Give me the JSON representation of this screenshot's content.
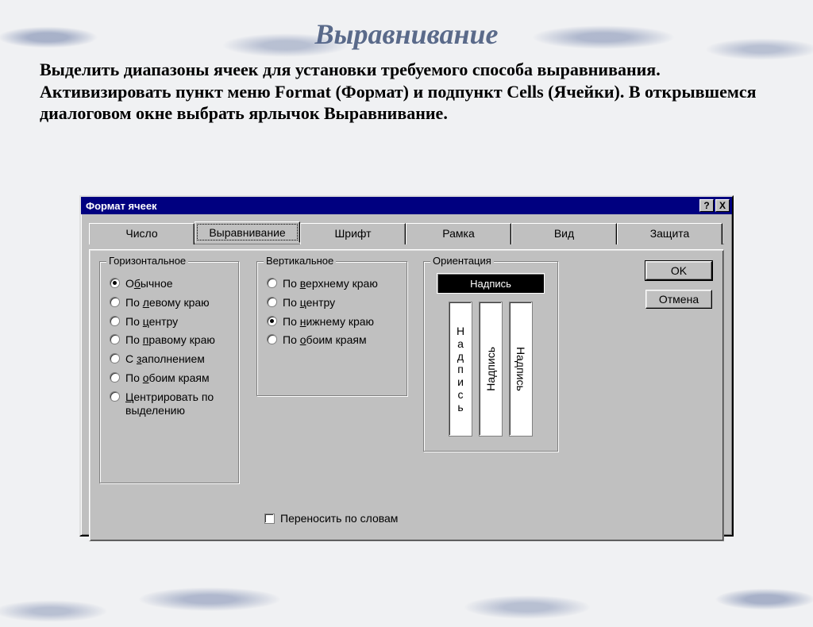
{
  "page": {
    "title": "Выравнивание",
    "intro": "Выделить диапазоны ячеек для установки требуемого способа выравнивания. Активизировать пункт меню Format (Формат) и подпункт Cells (Ячейки). В открывшемся диалоговом окне выбрать ярлычок Выравнивание."
  },
  "dialog": {
    "title": "Формат ячеек",
    "help_symbol": "?",
    "close_symbol": "X",
    "tabs": [
      "Число",
      "Выравнивание",
      "Шрифт",
      "Рамка",
      "Вид",
      "Защита"
    ],
    "active_tab_index": 1,
    "buttons": {
      "ok": "OK",
      "cancel": "Отмена"
    },
    "groups": {
      "horizontal": {
        "legend": "Горизонтальное",
        "options": [
          "Обычное",
          "По левому краю",
          "По центру",
          "По правому краю",
          "С заполнением",
          "По обоим краям",
          "Центрировать по выделению"
        ],
        "selected": 0
      },
      "vertical": {
        "legend": "Вертикальное",
        "options": [
          "По верхнему краю",
          "По центру",
          "По нижнему краю",
          "По обоим краям"
        ],
        "selected": 2
      },
      "orientation": {
        "legend": "Ориентация",
        "label": "Надпись"
      }
    },
    "wrap_text": {
      "label": "Переносить по словам",
      "checked": false
    }
  }
}
